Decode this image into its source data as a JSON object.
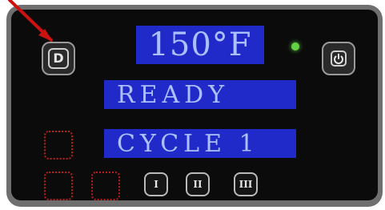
{
  "display": {
    "temperature": "150°F",
    "status": "READY",
    "cycle": "CYCLE 1"
  },
  "buttons": {
    "d_label": "D",
    "b1_label": "I",
    "b2_label": "II",
    "b3_label": "III"
  },
  "indicators": {
    "led_color": "#63d343"
  },
  "icons": {
    "d_button_icon": "d-icon",
    "power_icon": "power-icon"
  },
  "annotation": {
    "arrow_color": "#cc1111"
  }
}
